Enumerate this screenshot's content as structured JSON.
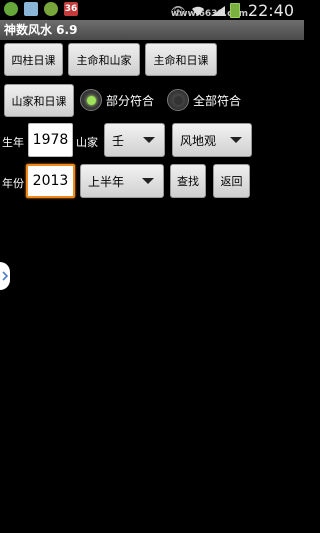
{
  "status_bar": {
    "time": "22:40",
    "watermark": "www.6631.com",
    "icons": [
      "wechat-icon",
      "picture-icon",
      "bug-icon",
      "app-36-icon",
      "eye-icon",
      "wifi-icon",
      "signal-icon",
      "battery-icon"
    ],
    "app36_text": "36"
  },
  "app": {
    "title": "神数风水 6.9"
  },
  "buttons": {
    "sizhu": "四柱日课",
    "zhuming_shanjia": "主命和山家",
    "zhuming_rike": "主命和日课",
    "shanjia_rike": "山家和日课",
    "search": "查找",
    "back": "返回"
  },
  "radio": {
    "partial": {
      "label": "部分符合",
      "checked": true
    },
    "full": {
      "label": "全部符合",
      "checked": false
    }
  },
  "form": {
    "birth_year_label": "生年",
    "birth_year_value": "1978",
    "shanjia_label": "山家",
    "shanjia_value": "壬",
    "fengdi_value": "风地观",
    "year_label": "年份",
    "year_value": "2013",
    "half_value": "上半年"
  },
  "colors": {
    "accent_focus": "#f08a1c",
    "radio_on": "#9fe25a",
    "titlebar": "#5a5a5a"
  }
}
